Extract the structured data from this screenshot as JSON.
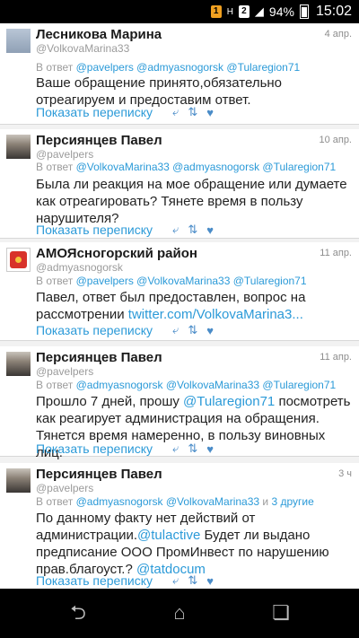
{
  "status": {
    "sim1": "1",
    "sim2": "2",
    "battery": "94%",
    "time": "15:02"
  },
  "tweets": [
    {
      "name": "Лесникова Марина",
      "handle": "@VolkovaMarina33",
      "date": "4 апр.",
      "reply_prefix": "В ответ",
      "reply_to": "@pavelpers @admyasnogorsk @Tularegion71",
      "reply_extra": "",
      "body_parts": [
        "Ваше обращение принято,обязательно",
        "отреагируем и предоставим ответ."
      ],
      "show_label": "Показать переписку"
    },
    {
      "name": "Персиянцев Павел",
      "handle": "@pavelpers",
      "date": "10 апр.",
      "reply_prefix": "В ответ",
      "reply_to": "@VolkovaMarina33 @admyasnogorsk @Tularegion71",
      "reply_extra": "",
      "body_parts": [
        "Была ли реакция на мое обращение или думаете",
        "как отреагировать? Тянете время в пользу",
        "нарушителя?"
      ],
      "show_label": "Показать переписку"
    },
    {
      "name": "АМОЯсногорский район",
      "handle": "@admyasnogorsk",
      "date": "11 апр.",
      "reply_prefix": "В ответ",
      "reply_to": "@pavelpers @VolkovaMarina33 @Tularegion71",
      "reply_extra": "",
      "body_parts": [
        "Павел, ответ был предоставлен, вопрос на",
        "рассмотрении "
      ],
      "body_link": "twitter.com/VolkovaMarina3...",
      "show_label": "Показать переписку"
    },
    {
      "name": "Персиянцев Павел",
      "handle": "@pavelpers",
      "date": "11 апр.",
      "reply_prefix": "В ответ",
      "reply_to": "@admyasnogorsk @VolkovaMarina33 @Tularegion71",
      "reply_extra": "",
      "body_pre": "Прошло 7 дней, прошу ",
      "body_mention": "@Tularegion71",
      "body_post": " посмотреть",
      "body_parts": [
        "как реагирует администрация на обращения.",
        "Тянется время намеренно, в пользу виновных лиц."
      ],
      "show_label": "Показать переписку"
    },
    {
      "name": "Персиянцев Павел",
      "handle": "@pavelpers",
      "date": "3 ч",
      "reply_prefix": "В ответ",
      "reply_to": "@admyasnogorsk @VolkovaMarina33",
      "reply_and": "и",
      "reply_extra": "3 другие",
      "body_l1": "По данному факту нет действий от",
      "body_l2a": "администрации.",
      "body_l2m": "@tulactive",
      "body_l2b": " Будет ли выдано",
      "body_l3": "предписание ООО ПромИнвест по нарушению",
      "body_l4a": "прав.благоуст.? ",
      "body_l4m": "@tatdocum",
      "show_label": "Показать переписку"
    }
  ],
  "icons": {
    "reply": "reply-icon",
    "retweet": "retweet-icon",
    "favorite": "heart-icon",
    "back": "back-icon",
    "home": "home-icon",
    "recents": "recents-icon"
  }
}
